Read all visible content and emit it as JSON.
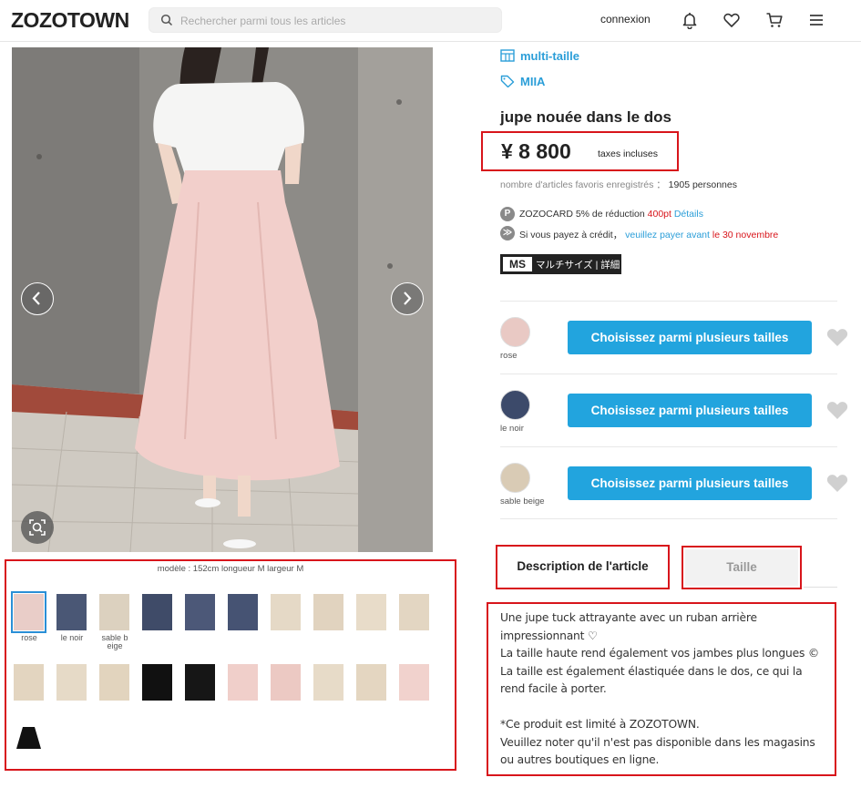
{
  "header": {
    "logo": "ZOZOTOWN",
    "search_placeholder": "Rechercher parmi tous les articles",
    "login": "connexion"
  },
  "gallery": {
    "model_note": "modèle : 152cm longueur M largeur M",
    "thumb_labels": {
      "rose": "rose",
      "noir": "le noir",
      "sable": "sable b eige"
    }
  },
  "product": {
    "tag_size": "multi-taille",
    "tag_brand": "MIIA",
    "title": "jupe nouée dans le dos",
    "price": "¥ 8 800",
    "tax_note": "taxes incluses",
    "fav_label": "nombre d'articles favoris enregistrés ：",
    "fav_count": "1905 personnes",
    "zozocard_prefix": "ZOZOCARD 5% de réduction",
    "zozocard_points": "400pt",
    "zozocard_link": "Détails",
    "credit_prefix": "Si vous payez à crédit，",
    "credit_link": "veuillez payer avant",
    "credit_date": "le 30 novembre",
    "badge_ms": "MS",
    "badge_text": "マルチサイズ | 詳細"
  },
  "colors": [
    {
      "label": "rose",
      "button": "Choisissez parmi plusieurs tailles",
      "swatch": "#e9c9c4"
    },
    {
      "label": "le noir",
      "button": "Choisissez parmi plusieurs tailles",
      "swatch": "#3c4a6a"
    },
    {
      "label": "sable beige",
      "button": "Choisissez parmi plusieurs tailles",
      "swatch": "#d9cbb5"
    }
  ],
  "tabs": {
    "description": "Description de l'article",
    "size": "Taille"
  },
  "description": "Une jupe tuck attrayante avec un ruban arrière impressionnant ♡\nLa taille haute rend également vos jambes plus longues ©\nLa taille est également élastiquée dans le dos, ce qui la rend facile à porter.\n\n*Ce produit est limité à ZOZOTOWN.\nVeuillez noter qu'il n'est pas disponible dans les magasins ou autres boutiques en ligne.",
  "theme": {
    "accent_blue": "#22a4de",
    "highlight_red": "#d8151b"
  }
}
